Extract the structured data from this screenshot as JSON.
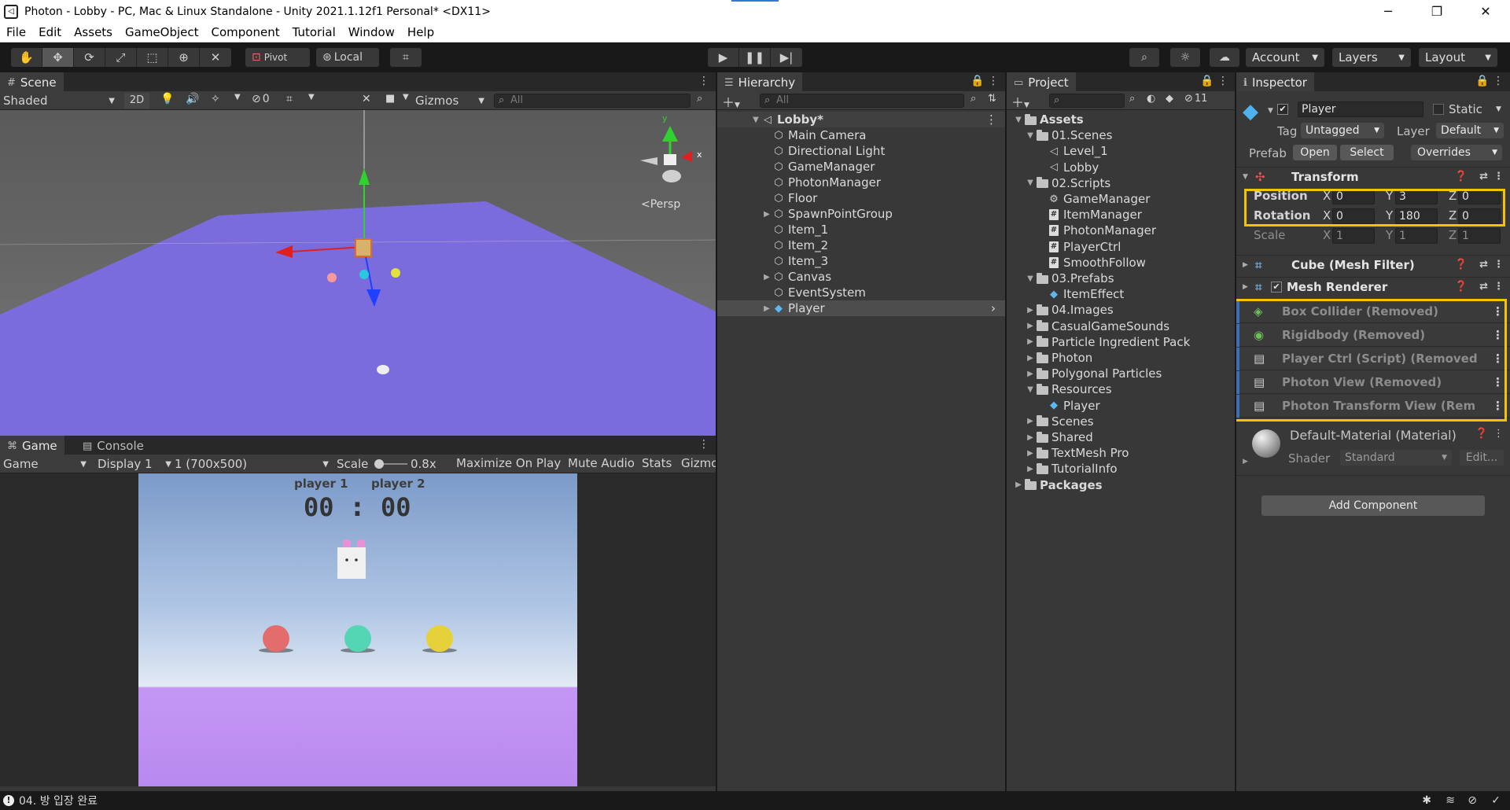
{
  "window": {
    "title": "Photon - Lobby - PC, Mac & Linux Standalone - Unity 2021.1.12f1 Personal* <DX11>",
    "minimize": "─",
    "maximize": "❐",
    "close": "✕"
  },
  "menu": [
    "File",
    "Edit",
    "Assets",
    "GameObject",
    "Component",
    "Tutorial",
    "Window",
    "Help"
  ],
  "toolbar": {
    "pivot_label": "Pivot",
    "local_label": "Local",
    "account_label": "Account",
    "layers_label": "Layers",
    "layout_label": "Layout"
  },
  "scene": {
    "tab_label": "Scene",
    "shading_mode": "Shaded",
    "mode_2d": "2D",
    "hidden_count": "0",
    "gizmos_label": "Gizmos",
    "search_placeholder": "All",
    "persp_label": "<Persp",
    "axis_y": "y",
    "axis_x": "x"
  },
  "game": {
    "tab_game": "Game",
    "tab_console": "Console",
    "view_mode": "Game",
    "display": "Display 1",
    "resolution": "1 (700x500)",
    "scale_label": "Scale",
    "scale_value": "0.8x",
    "maximize_on_play": "Maximize On Play",
    "mute_audio": "Mute Audio",
    "stats": "Stats",
    "gizmos": "Gizmo",
    "player1_label": "player 1",
    "player2_label": "player 2",
    "score_left": "00",
    "score_sep": ":",
    "score_right": "00"
  },
  "hierarchy": {
    "tab_label": "Hierarchy",
    "search_placeholder": "All",
    "scene_name": "Lobby*",
    "items": [
      "Main Camera",
      "Directional Light",
      "GameManager",
      "PhotonManager",
      "Floor",
      "SpawnPointGroup",
      "Item_1",
      "Item_2",
      "Item_3",
      "Canvas",
      "EventSystem",
      "Player"
    ]
  },
  "project": {
    "tab_label": "Project",
    "hidden_count": "11",
    "tree": [
      {
        "label": "Assets",
        "level": 0,
        "type": "folder-open",
        "bold": true
      },
      {
        "label": "01.Scenes",
        "level": 1,
        "type": "folder-open"
      },
      {
        "label": "Level_1",
        "level": 2,
        "type": "scene"
      },
      {
        "label": "Lobby",
        "level": 2,
        "type": "scene"
      },
      {
        "label": "02.Scripts",
        "level": 1,
        "type": "folder-open"
      },
      {
        "label": "GameManager",
        "level": 2,
        "type": "gear"
      },
      {
        "label": "ItemManager",
        "level": 2,
        "type": "script"
      },
      {
        "label": "PhotonManager",
        "level": 2,
        "type": "script"
      },
      {
        "label": "PlayerCtrl",
        "level": 2,
        "type": "script"
      },
      {
        "label": "SmoothFollow",
        "level": 2,
        "type": "script"
      },
      {
        "label": "03.Prefabs",
        "level": 1,
        "type": "folder-open"
      },
      {
        "label": "ItemEffect",
        "level": 2,
        "type": "prefab"
      },
      {
        "label": "04.Images",
        "level": 1,
        "type": "folder"
      },
      {
        "label": "CasualGameSounds",
        "level": 1,
        "type": "folder"
      },
      {
        "label": "Particle Ingredient Pack",
        "level": 1,
        "type": "folder"
      },
      {
        "label": "Photon",
        "level": 1,
        "type": "folder"
      },
      {
        "label": "Polygonal Particles",
        "level": 1,
        "type": "folder"
      },
      {
        "label": "Resources",
        "level": 1,
        "type": "folder-open"
      },
      {
        "label": "Player",
        "level": 2,
        "type": "prefab"
      },
      {
        "label": "Scenes",
        "level": 1,
        "type": "folder"
      },
      {
        "label": "Shared",
        "level": 1,
        "type": "folder"
      },
      {
        "label": "TextMesh Pro",
        "level": 1,
        "type": "folder"
      },
      {
        "label": "TutorialInfo",
        "level": 1,
        "type": "folder"
      },
      {
        "label": "Packages",
        "level": 0,
        "type": "folder",
        "bold": true
      }
    ]
  },
  "inspector": {
    "tab_label": "Inspector",
    "object_name": "Player",
    "static_label": "Static",
    "tag_label": "Tag",
    "tag_value": "Untagged",
    "layer_label": "Layer",
    "layer_value": "Default",
    "prefab_label": "Prefab",
    "open_label": "Open",
    "select_label": "Select",
    "overrides_label": "Overrides",
    "transform": {
      "title": "Transform",
      "position_label": "Position",
      "rotation_label": "Rotation",
      "scale_label": "Scale",
      "x_label": "X",
      "y_label": "Y",
      "z_label": "Z",
      "position": [
        "0",
        "3",
        "0"
      ],
      "rotation": [
        "0",
        "180",
        "0"
      ],
      "scale": [
        "1",
        "1",
        "1"
      ]
    },
    "mesh_filter_title": "Cube (Mesh Filter)",
    "mesh_renderer_title": "Mesh Renderer",
    "removed_components": [
      "Box Collider (Removed)",
      "Rigidbody (Removed)",
      "Player Ctrl (Script) (Removed",
      "Photon View (Removed)",
      "Photon Transform View (Rem"
    ],
    "material_name": "Default-Material (Material)",
    "shader_label": "Shader",
    "shader_value": "Standard",
    "edit_label": "Edit...",
    "add_component": "Add Component",
    "highlight_color": "#f2c500"
  },
  "status": {
    "message": "04. 방 입장 완료"
  },
  "colors": {
    "floor": "#7b6cde",
    "game_floor": "#bb8def",
    "ball_red": "#e36d6d",
    "ball_teal": "#54d6b4",
    "ball_yellow": "#e6d13a"
  }
}
